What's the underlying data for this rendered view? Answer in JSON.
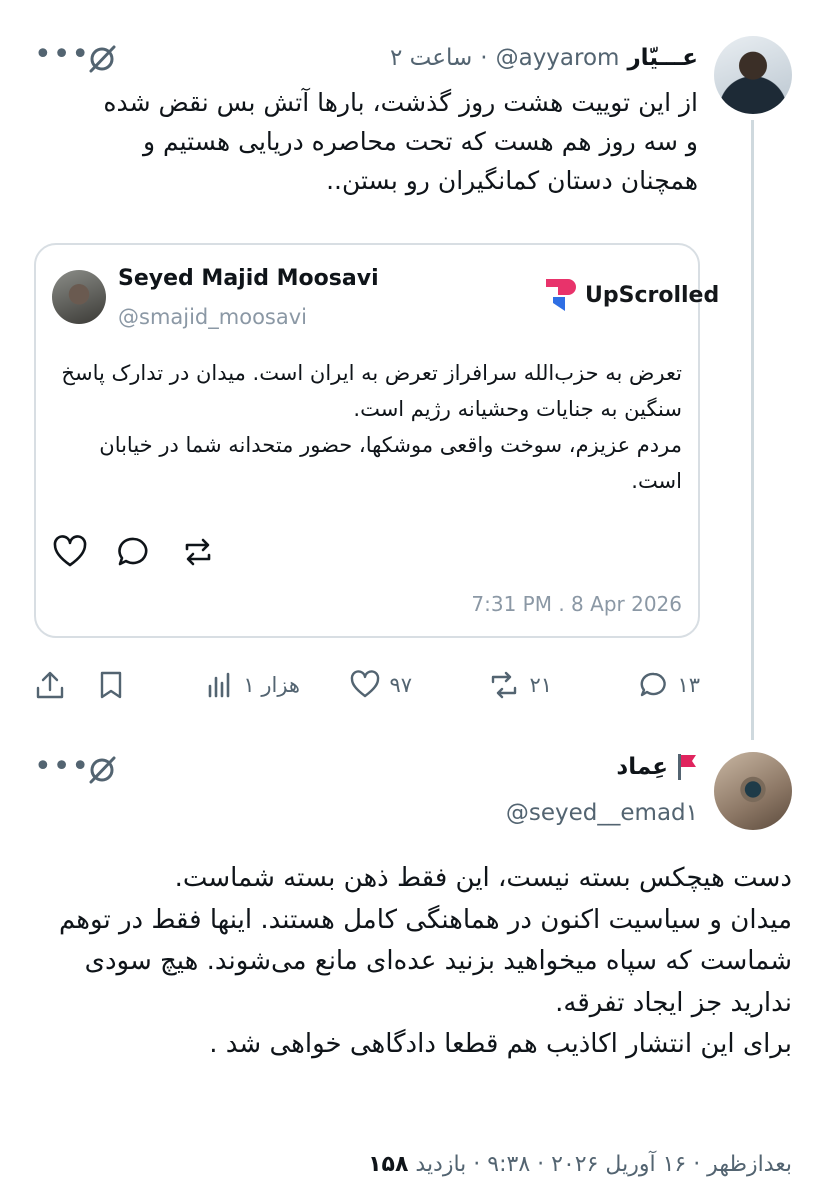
{
  "tweet1": {
    "name": "عـــیّار",
    "handle": "@ayyarom",
    "separator": "·",
    "time": "ساعت ۲",
    "text": "از این توییت هشت روز گذشت، بارها آتش بس نقض شده و سه روز هم هست که تحت محاصره دریایی هستیم و همچنان دستان کمانگیران رو بستن..",
    "quote": {
      "name": "Seyed Majid Moosavi",
      "handle": "@smajid_moosavi",
      "source": "UpScrolled",
      "line1": "تعرض به حزب‌الله سرافراز تعرض به ایران است. میدان در تدارک پاسخ سنگین به جنایات وحشیانه رژیم است.",
      "line2": "مردم عزیزم، سوخت واقعی موشکها، حضور متحدانه شما در خیابان است.",
      "date": "7:31 PM . 8 Apr 2026"
    },
    "actions": {
      "replies": "۱۳",
      "retweets": "۲۱",
      "likes": "۹۷",
      "views": "هزار ۱"
    }
  },
  "tweet2": {
    "name": "عِماد",
    "handle": "@seyed__emad۱",
    "text_lines": [
      "دست هیچکس بسته نیست، این فقط ذهن بسته شماست.",
      "میدان و سیاسیت اکنون در هماهنگی کامل هستند. اینها فقط در توهم شماست که سپاه میخواهید بزنید عده‌ای مانع می‌شوند. هیچ سودی ندارید جز ایجاد تفرقه.",
      "برای این انتشار اکاذیب هم قطعا دادگاهی خواهی شد ."
    ],
    "meta_prefix": "بعدازظهر · ۱۶ آوریل ۲۰۲۶ · ۹:۳۸ · بازدید",
    "views": "۱۵۸"
  },
  "colors": {
    "text": "#0f1419",
    "muted": "#536471",
    "border": "#d8dee3",
    "flag": "#e0245e",
    "upscrolled_pink": "#e8336b",
    "upscrolled_blue": "#2f6fe4"
  }
}
